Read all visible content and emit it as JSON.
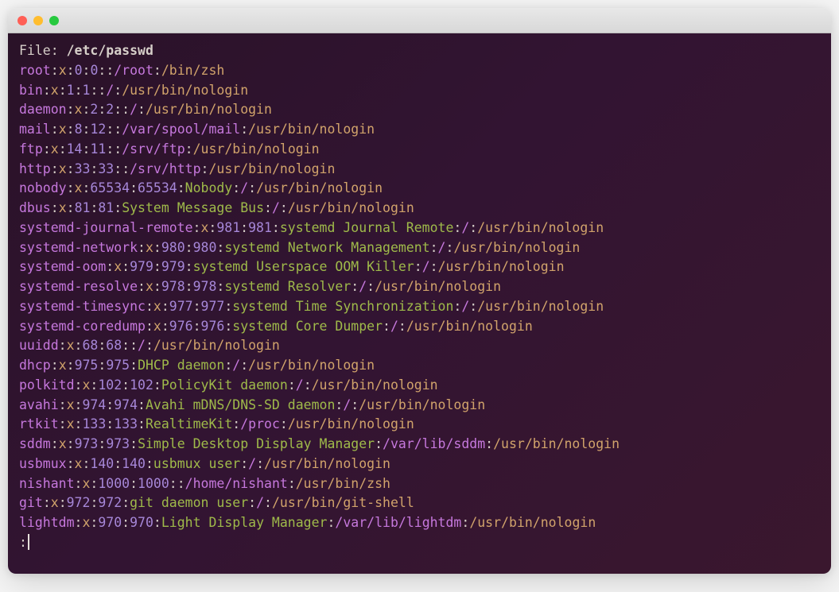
{
  "header": {
    "label": "File: ",
    "path": "/etc/passwd"
  },
  "prompt_prefix": ":",
  "entries": [
    {
      "user": "root",
      "x": "x",
      "uid": "0",
      "gid": "0",
      "gecos": "",
      "dir": "/root",
      "shell": "/bin/zsh"
    },
    {
      "user": "bin",
      "x": "x",
      "uid": "1",
      "gid": "1",
      "gecos": "",
      "dir": "/",
      "shell": "/usr/bin/nologin"
    },
    {
      "user": "daemon",
      "x": "x",
      "uid": "2",
      "gid": "2",
      "gecos": "",
      "dir": "/",
      "shell": "/usr/bin/nologin"
    },
    {
      "user": "mail",
      "x": "x",
      "uid": "8",
      "gid": "12",
      "gecos": "",
      "dir": "/var/spool/mail",
      "shell": "/usr/bin/nologin"
    },
    {
      "user": "ftp",
      "x": "x",
      "uid": "14",
      "gid": "11",
      "gecos": "",
      "dir": "/srv/ftp",
      "shell": "/usr/bin/nologin"
    },
    {
      "user": "http",
      "x": "x",
      "uid": "33",
      "gid": "33",
      "gecos": "",
      "dir": "/srv/http",
      "shell": "/usr/bin/nologin"
    },
    {
      "user": "nobody",
      "x": "x",
      "uid": "65534",
      "gid": "65534",
      "gecos": "Nobody",
      "dir": "/",
      "shell": "/usr/bin/nologin"
    },
    {
      "user": "dbus",
      "x": "x",
      "uid": "81",
      "gid": "81",
      "gecos": "System Message Bus",
      "dir": "/",
      "shell": "/usr/bin/nologin"
    },
    {
      "user": "systemd-journal-remote",
      "x": "x",
      "uid": "981",
      "gid": "981",
      "gecos": "systemd Journal Remote",
      "dir": "/",
      "shell": "/usr/bin/nologin"
    },
    {
      "user": "systemd-network",
      "x": "x",
      "uid": "980",
      "gid": "980",
      "gecos": "systemd Network Management",
      "dir": "/",
      "shell": "/usr/bin/nologin"
    },
    {
      "user": "systemd-oom",
      "x": "x",
      "uid": "979",
      "gid": "979",
      "gecos": "systemd Userspace OOM Killer",
      "dir": "/",
      "shell": "/usr/bin/nologin"
    },
    {
      "user": "systemd-resolve",
      "x": "x",
      "uid": "978",
      "gid": "978",
      "gecos": "systemd Resolver",
      "dir": "/",
      "shell": "/usr/bin/nologin"
    },
    {
      "user": "systemd-timesync",
      "x": "x",
      "uid": "977",
      "gid": "977",
      "gecos": "systemd Time Synchronization",
      "dir": "/",
      "shell": "/usr/bin/nologin"
    },
    {
      "user": "systemd-coredump",
      "x": "x",
      "uid": "976",
      "gid": "976",
      "gecos": "systemd Core Dumper",
      "dir": "/",
      "shell": "/usr/bin/nologin"
    },
    {
      "user": "uuidd",
      "x": "x",
      "uid": "68",
      "gid": "68",
      "gecos": "",
      "dir": "/",
      "shell": "/usr/bin/nologin"
    },
    {
      "user": "dhcp",
      "x": "x",
      "uid": "975",
      "gid": "975",
      "gecos": "DHCP daemon",
      "dir": "/",
      "shell": "/usr/bin/nologin"
    },
    {
      "user": "polkitd",
      "x": "x",
      "uid": "102",
      "gid": "102",
      "gecos": "PolicyKit daemon",
      "dir": "/",
      "shell": "/usr/bin/nologin"
    },
    {
      "user": "avahi",
      "x": "x",
      "uid": "974",
      "gid": "974",
      "gecos": "Avahi mDNS/DNS-SD daemon",
      "dir": "/",
      "shell": "/usr/bin/nologin"
    },
    {
      "user": "rtkit",
      "x": "x",
      "uid": "133",
      "gid": "133",
      "gecos": "RealtimeKit",
      "dir": "/proc",
      "shell": "/usr/bin/nologin"
    },
    {
      "user": "sddm",
      "x": "x",
      "uid": "973",
      "gid": "973",
      "gecos": "Simple Desktop Display Manager",
      "dir": "/var/lib/sddm",
      "shell": "/usr/bin/nologin"
    },
    {
      "user": "usbmux",
      "x": "x",
      "uid": "140",
      "gid": "140",
      "gecos": "usbmux user",
      "dir": "/",
      "shell": "/usr/bin/nologin"
    },
    {
      "user": "nishant",
      "x": "x",
      "uid": "1000",
      "gid": "1000",
      "gecos": "",
      "dir": "/home/nishant",
      "shell": "/usr/bin/zsh"
    },
    {
      "user": "git",
      "x": "x",
      "uid": "972",
      "gid": "972",
      "gecos": "git daemon user",
      "dir": "/",
      "shell": "/usr/bin/git-shell"
    },
    {
      "user": "lightdm",
      "x": "x",
      "uid": "970",
      "gid": "970",
      "gecos": "Light Display Manager",
      "dir": "/var/lib/lightdm",
      "shell": "/usr/bin/nologin"
    }
  ]
}
